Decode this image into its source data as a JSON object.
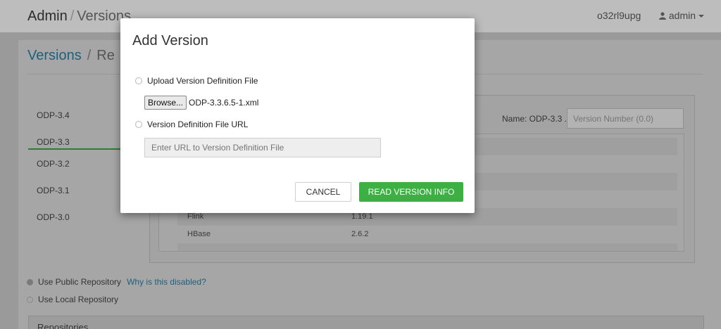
{
  "topbar": {
    "crumb_root": "Admin",
    "crumb_sep": "/",
    "crumb_current": "Versions",
    "cluster_name": "o32rl9upg",
    "user_label": "admin",
    "user_icon": "user-icon",
    "caret_icon": "caret-down-icon"
  },
  "page": {
    "title_link": "Versions",
    "title_sep": "/",
    "title_rest": "Re"
  },
  "versions": [
    {
      "label": "ODP-3.4"
    },
    {
      "label": "ODP-3.3",
      "selected": true
    },
    {
      "label": "ODP-3.2"
    },
    {
      "label": "ODP-3.1"
    },
    {
      "label": "ODP-3.0"
    }
  ],
  "panel": {
    "name_label": "Name: ODP-3.3 .",
    "version_number_placeholder": "Version Number (0.0)",
    "stack_rows": [
      {
        "name": "Flink",
        "version": "1.19.1"
      },
      {
        "name": "HBase",
        "version": "2.6.2"
      }
    ]
  },
  "repository": {
    "public_label": "Use Public Repository",
    "why_disabled_link": "Why is this disabled?",
    "local_label": "Use Local Repository",
    "section_header": "Repositories"
  },
  "modal": {
    "title": "Add Version",
    "option_upload_label": "Upload Version Definition File",
    "browse_label": "Browse...",
    "file_name": "ODP-3.3.6.5-1.xml",
    "option_url_label": "Version Definition File URL",
    "url_placeholder": "Enter URL to Version Definition File",
    "cancel_label": "CANCEL",
    "read_label": "READ VERSION INFO"
  },
  "colors": {
    "primary_green": "#3cb043",
    "link_blue": "#2f8fbd",
    "selected_tab_green": "#2e7d32"
  }
}
